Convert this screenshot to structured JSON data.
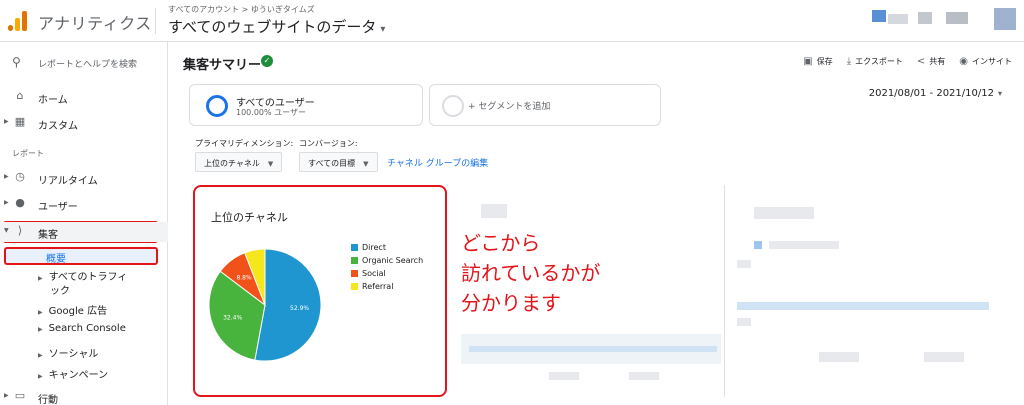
{
  "header": {
    "app_title": "アナリティクス",
    "breadcrumb": "すべてのアカウント > ゆういぎタイムズ",
    "property": "すべてのウェブサイトのデータ",
    "property_caret": "▾"
  },
  "sidebar": {
    "search_placeholder": "レポートとヘルプを検索",
    "items_top": [
      {
        "label": "ホーム",
        "icon": "home-icon"
      },
      {
        "label": "カスタム",
        "icon": "dashboard-icon"
      }
    ],
    "section_label": "レポート",
    "items_reports": [
      {
        "label": "リアルタイム",
        "icon": "clock-icon"
      },
      {
        "label": "ユーザー",
        "icon": "person-icon"
      },
      {
        "label": "集客",
        "icon": "acquisition-icon"
      }
    ],
    "acquisition_sub": {
      "overview": "概要",
      "all_traffic_line1": "すべてのトラフィ",
      "all_traffic_line2": "ック",
      "google_ads": "Google 広告",
      "search_console": "Search Console",
      "social": "ソーシャル",
      "campaigns": "キャンペーン"
    },
    "behavior": {
      "label": "行動",
      "icon": "behavior-icon"
    }
  },
  "main": {
    "title": "集客サマリー",
    "toolbar": {
      "save": "保存",
      "export": "エクスポート",
      "share": "共有",
      "insights": "インサイト"
    },
    "segments": {
      "active_name": "すべてのユーザー",
      "active_pct": "100.00% ユーザー",
      "add_label": "+ セグメントを追加"
    },
    "date_range": "2021/08/01 - 2021/10/12",
    "primary_dimension_label": "プライマリディメンション:",
    "conversion_label": "コンバージョン:",
    "channel_select": "上位のチャネル",
    "goal_select": "すべての目標",
    "channel_group_link": "チャネル グループの編集",
    "annotation": [
      "どこから",
      "訪れているかが",
      "分かります"
    ]
  },
  "chart_data": {
    "type": "pie",
    "title": "上位のチャネル",
    "labels": [
      "Direct",
      "Organic Search",
      "Social",
      "Referral"
    ],
    "values": [
      52.9,
      32.4,
      8.8,
      5.9
    ],
    "value_labels": [
      "52.9%",
      "32.4%",
      "8.8%",
      ""
    ],
    "colors": [
      "#1f96d0",
      "#48b43d",
      "#f0521a",
      "#f5e61e"
    ],
    "legend_position": "right"
  }
}
